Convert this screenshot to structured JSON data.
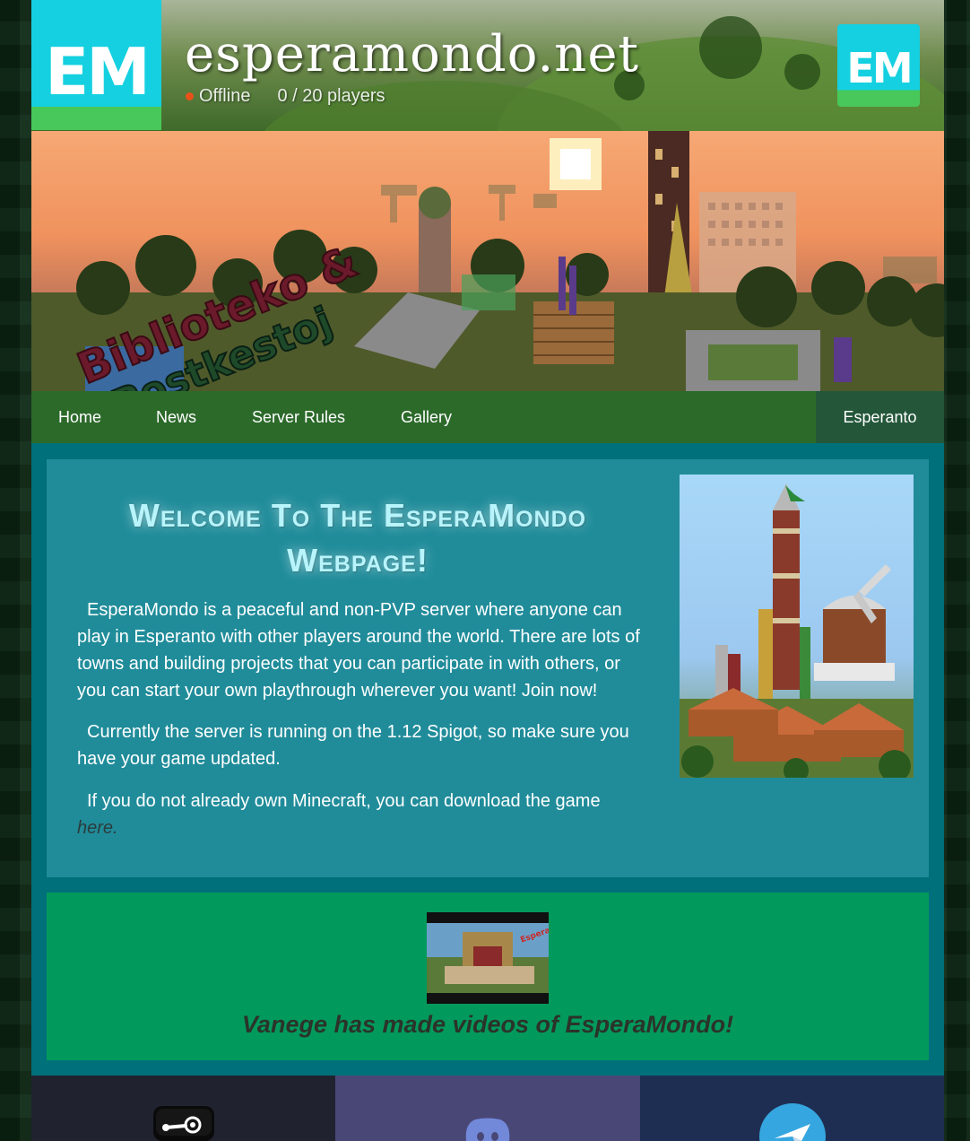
{
  "header": {
    "logo_text": "EM",
    "site_title": "esperamondo.net",
    "status": "Offline",
    "players": "0 / 20 players",
    "status_color": "#e8521a",
    "logo_colors": {
      "top": "#15d0e0",
      "bottom": "#48c85a"
    }
  },
  "banner": {
    "sign_line1": "Biblioteko &",
    "sign_line2": "Postkestoj"
  },
  "nav": {
    "items": [
      {
        "label": "Home"
      },
      {
        "label": "News"
      },
      {
        "label": "Server Rules"
      },
      {
        "label": "Gallery"
      }
    ],
    "language": "Esperanto",
    "bar_color": "#2c6a2a"
  },
  "welcome": {
    "title": "Welcome To The EsperaMondo Webpage!",
    "para1": "EsperaMondo is a peaceful and non-PVP server where anyone can play in Esperanto with other players around the world. There are lots of towns and building projects that you can participate in with others, or you can start your own playthrough wherever you want! Join now!",
    "para2": "Currently the server is running on the 1.12 Spigot, so make sure you have your game updated.",
    "para3_text": "If you do not already own Minecraft, you can download the game",
    "para3_link": "here.",
    "panel_color": "#208c9a"
  },
  "videos": {
    "thumb_text": "Esperanto",
    "caption": "Vanege has made videos of EsperaMondo!",
    "panel_color": "#029a5c"
  },
  "social": [
    {
      "icon": "steam-icon",
      "color": "#21222f"
    },
    {
      "icon": "discord-icon",
      "color": "#494776"
    },
    {
      "icon": "telegram-icon",
      "color": "#1e2e52"
    }
  ]
}
